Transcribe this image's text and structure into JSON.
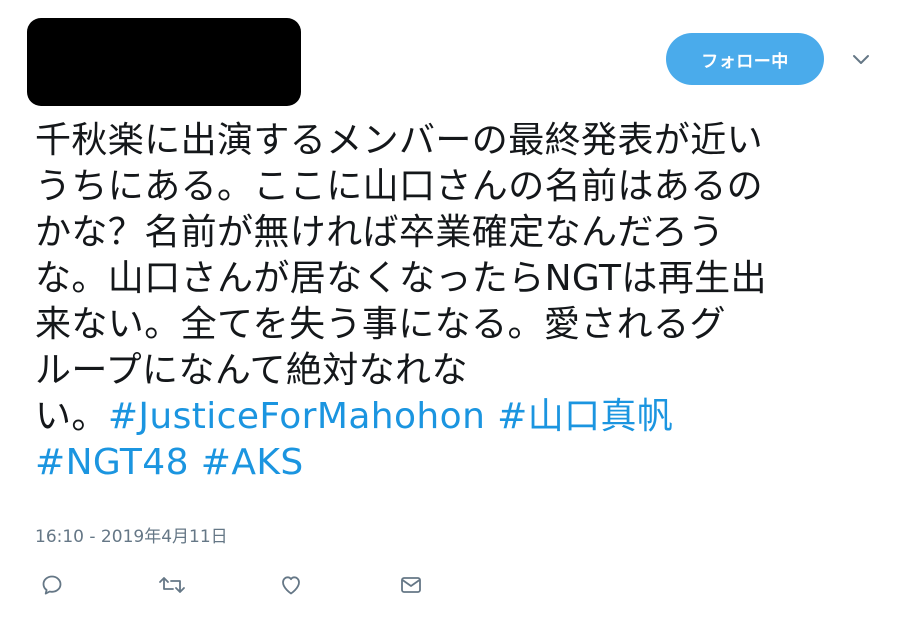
{
  "tweet": {
    "follow_label": "フォロー中",
    "lines": [
      [
        {
          "t": "千秋楽に出演するメンバーの最終発表が近い"
        }
      ],
      [
        {
          "t": "うちにある。ここに山口さんの名前はあるの"
        }
      ],
      [
        {
          "t": "かな？名前が無ければ卒業確定なんだろう"
        }
      ],
      [
        {
          "t": "な。山口さんが居なくなったらNGTは再生出"
        }
      ],
      [
        {
          "t": "来ない。全てを失う事になる。愛されるグ"
        }
      ],
      [
        {
          "t": "ループになんて絶対なれな"
        }
      ],
      [
        {
          "t": "い。"
        },
        {
          "t": "#JusticeForMahohon",
          "tag": true
        },
        {
          "t": " "
        },
        {
          "t": "#山口真帆",
          "tag": true
        }
      ],
      [
        {
          "t": "#NGT48",
          "tag": true
        },
        {
          "t": " "
        },
        {
          "t": "#AKS",
          "tag": true
        }
      ]
    ],
    "timestamp": "16:10 - 2019年4月11日"
  },
  "icons": {
    "menu": "chevron-down-icon",
    "reply": "reply-icon",
    "retweet": "retweet-icon",
    "like": "heart-icon",
    "message": "envelope-icon"
  },
  "colors": {
    "follow_bg": "#4aabeb",
    "hashtag": "#1b95e0",
    "meta": "#657786",
    "text": "#14171a"
  }
}
